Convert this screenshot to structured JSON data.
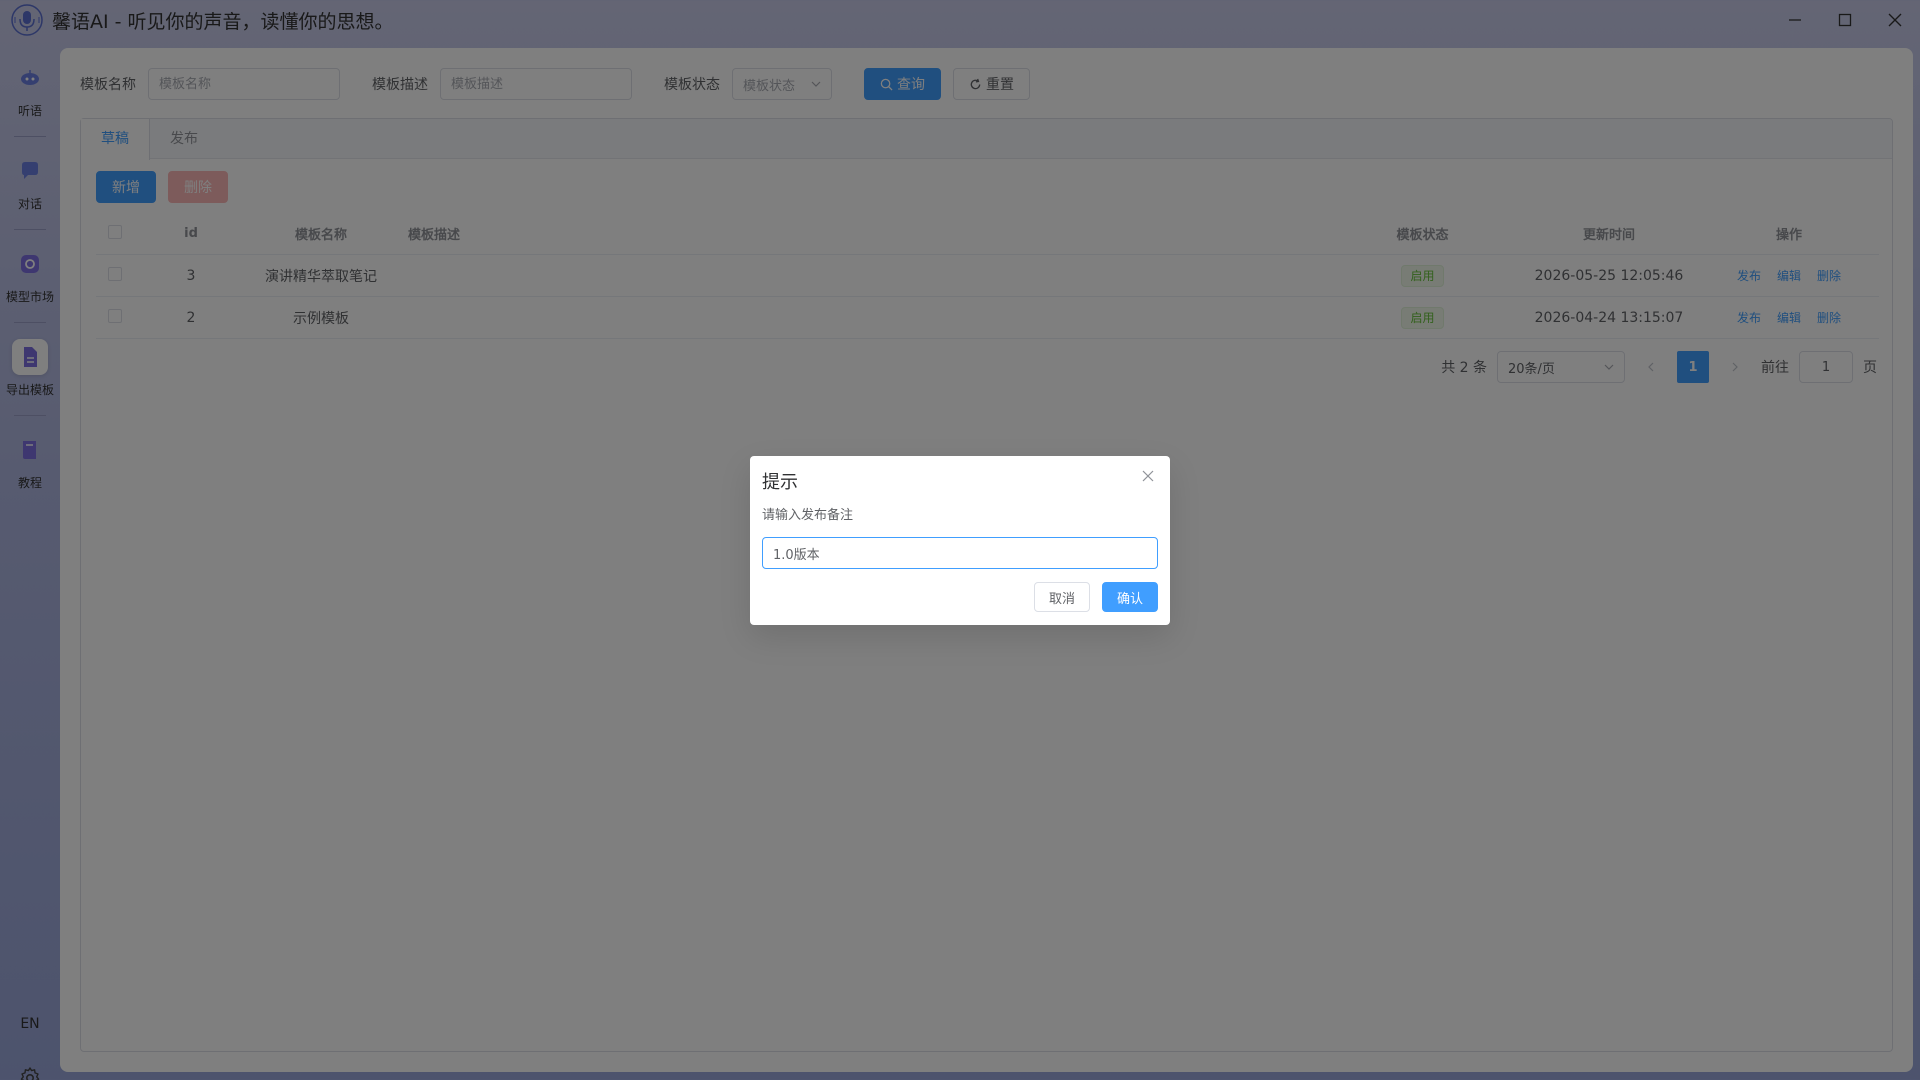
{
  "app": {
    "title": "馨语AI - 听见你的声音，读懂你的思想。",
    "logo_icon": "microphone-wave-icon"
  },
  "window": {
    "minimize_icon": "minimize-icon",
    "maximize_icon": "maximize-icon",
    "close_icon": "close-icon"
  },
  "sidebar": {
    "items": [
      {
        "label": "听语",
        "icon": "robot-icon"
      },
      {
        "label": "对话",
        "icon": "chat-icon"
      },
      {
        "label": "模型市场",
        "icon": "model-market-icon"
      },
      {
        "label": "导出模板",
        "icon": "document-icon",
        "active": true
      },
      {
        "label": "教程",
        "icon": "book-icon"
      }
    ],
    "lang": "EN",
    "settings_icon": "gear-icon"
  },
  "filters": {
    "name_label": "模板名称",
    "name_placeholder": "模板名称",
    "desc_label": "模板描述",
    "desc_placeholder": "模板描述",
    "status_label": "模板状态",
    "status_placeholder": "模板状态",
    "search_btn": "查询",
    "reset_btn": "重置"
  },
  "tabs": [
    {
      "label": "草稿",
      "active": true
    },
    {
      "label": "发布"
    }
  ],
  "actions": {
    "add": "新增",
    "delete": "删除"
  },
  "table": {
    "columns": {
      "id": "id",
      "name": "模板名称",
      "desc": "模板描述",
      "status": "模板状态",
      "time": "更新时间",
      "ops": "操作"
    },
    "rows": [
      {
        "id": "3",
        "name": "演讲精华萃取笔记",
        "desc": "",
        "status": "启用",
        "time": "2026-05-25 12:05:46",
        "ops": [
          "发布",
          "编辑",
          "删除"
        ]
      },
      {
        "id": "2",
        "name": "示例模板",
        "desc": "",
        "status": "启用",
        "time": "2026-04-24 13:15:07",
        "ops": [
          "发布",
          "编辑",
          "删除"
        ]
      }
    ]
  },
  "pagination": {
    "total_text": "共 2 条",
    "page_size": "20条/页",
    "current": "1",
    "goto_label": "前往",
    "goto_value": "1",
    "page_suffix": "页"
  },
  "dialog": {
    "title": "提示",
    "message": "请输入发布备注",
    "input_value": "1.0版本",
    "cancel": "取消",
    "confirm": "确认"
  },
  "colors": {
    "primary": "#409eff",
    "success": "#67c23a",
    "danger_disabled": "#fab6b6"
  }
}
